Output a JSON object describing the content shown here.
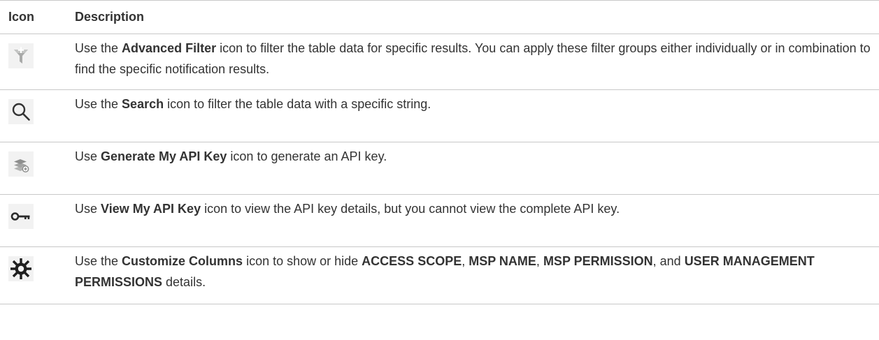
{
  "table": {
    "headers": {
      "icon": "Icon",
      "description": "Description"
    },
    "rows": [
      {
        "icon": "advanced-filter-icon",
        "parts": [
          {
            "t": "Use the "
          },
          {
            "t": "Advanced Filter",
            "b": true
          },
          {
            "t": " icon to filter the table data for specific results. You can apply these filter groups either individually or in combination to find the specific notification results."
          }
        ]
      },
      {
        "icon": "search-icon",
        "parts": [
          {
            "t": "Use the "
          },
          {
            "t": "Search",
            "b": true
          },
          {
            "t": " icon to filter the table data with a specific string."
          }
        ]
      },
      {
        "icon": "generate-api-key-icon",
        "parts": [
          {
            "t": "Use "
          },
          {
            "t": "Generate My API Key",
            "b": true
          },
          {
            "t": " icon to generate an API key."
          }
        ]
      },
      {
        "icon": "view-api-key-icon",
        "parts": [
          {
            "t": "Use "
          },
          {
            "t": "View My API Key",
            "b": true
          },
          {
            "t": " icon to view the API key details, but you cannot view the complete API key."
          }
        ]
      },
      {
        "icon": "customize-columns-icon",
        "parts": [
          {
            "t": "Use the "
          },
          {
            "t": "Customize Columns",
            "b": true
          },
          {
            "t": " icon to show or hide "
          },
          {
            "t": "ACCESS SCOPE",
            "b": true
          },
          {
            "t": ", "
          },
          {
            "t": "MSP NAME",
            "b": true
          },
          {
            "t": ", "
          },
          {
            "t": "MSP PERMISSION",
            "b": true
          },
          {
            "t": ", and "
          },
          {
            "t": "USER MANAGEMENT PERMISSIONS",
            "b": true
          },
          {
            "t": " details."
          }
        ]
      }
    ]
  },
  "colors": {
    "text": "#333333",
    "rule": "#c8c8c8",
    "icon_tile": "#f2f2f2"
  }
}
